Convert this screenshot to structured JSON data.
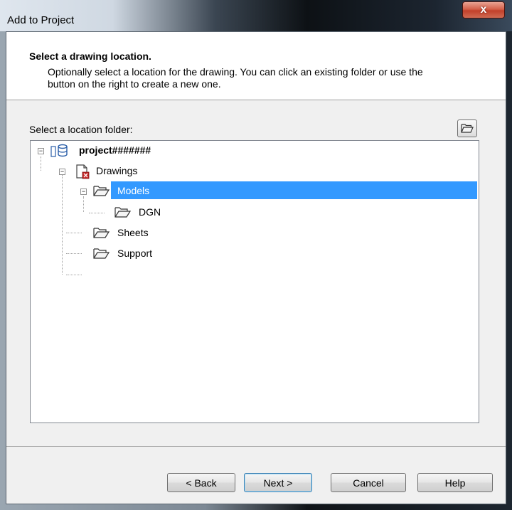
{
  "window": {
    "title": "Add to Project",
    "close_glyph": "x"
  },
  "header": {
    "title": "Select a drawing location.",
    "description": "Optionally select a location for the drawing. You can click an existing folder or use the button on the right to create a new one."
  },
  "location": {
    "label": "Select a location folder:",
    "new_folder_icon": "folder-open-icon"
  },
  "tree": {
    "root": "project#######",
    "drawings": "Drawings",
    "models": "Models",
    "dgn": "DGN",
    "sheets": "Sheets",
    "support": "Support",
    "selected": "Models",
    "expand_minus": "−"
  },
  "buttons": {
    "back": "< Back",
    "next": "Next >",
    "cancel": "Cancel",
    "help": "Help"
  },
  "colors": {
    "selection": "#3399ff",
    "close_red": "#c1402a"
  }
}
